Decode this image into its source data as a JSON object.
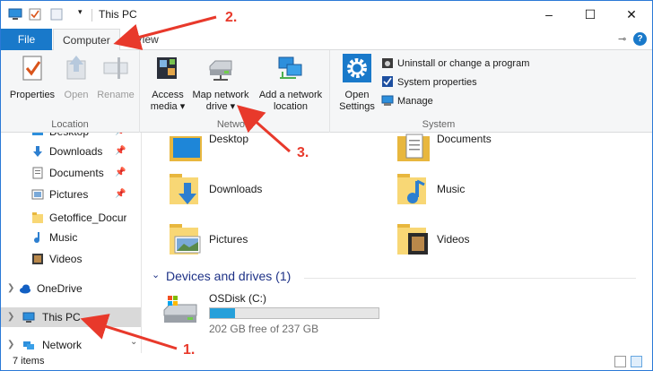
{
  "window": {
    "title": "This PC"
  },
  "tabs": {
    "file": "File",
    "computer": "Computer",
    "view": "View"
  },
  "ribbon": {
    "location": {
      "label": "Location",
      "properties": "Properties",
      "open": "Open",
      "rename": "Rename"
    },
    "network": {
      "label": "Network",
      "access_media_1": "Access",
      "access_media_2": "media ▾",
      "map_drive_1": "Map network",
      "map_drive_2": "drive ▾",
      "add_location_1": "Add a network",
      "add_location_2": "location"
    },
    "system": {
      "label": "System",
      "open_settings_1": "Open",
      "open_settings_2": "Settings",
      "uninstall": "Uninstall or change a program",
      "system_properties": "System properties",
      "manage": "Manage"
    }
  },
  "nav": {
    "items": [
      {
        "label": "Desktop",
        "icon": "desktop-icon",
        "pinned": true
      },
      {
        "label": "Downloads",
        "icon": "downloads-icon",
        "pinned": true
      },
      {
        "label": "Documents",
        "icon": "documents-icon",
        "pinned": true
      },
      {
        "label": "Pictures",
        "icon": "pictures-icon",
        "pinned": true
      },
      {
        "label": "Getoffice_Docur",
        "icon": "folder-icon",
        "pinned": false
      },
      {
        "label": "Music",
        "icon": "music-icon",
        "pinned": false
      },
      {
        "label": "Videos",
        "icon": "videos-icon",
        "pinned": false
      }
    ],
    "onedrive": "OneDrive",
    "thispc": "This PC",
    "network": "Network"
  },
  "content": {
    "folders": [
      {
        "label": "Desktop"
      },
      {
        "label": "Documents"
      },
      {
        "label": "Downloads"
      },
      {
        "label": "Music"
      },
      {
        "label": "Pictures"
      },
      {
        "label": "Videos"
      }
    ],
    "devices_header": "Devices and drives (1)",
    "drive": {
      "name": "OSDisk (C:)",
      "free_text": "202 GB free of 237 GB",
      "used_fraction": 0.15
    }
  },
  "status": {
    "count": "7 items"
  },
  "annotations": {
    "one": "1.",
    "two": "2.",
    "three": "3."
  },
  "colors": {
    "accent": "#1979ca",
    "arrow": "#e8392b",
    "drive_fill": "#26a0da"
  }
}
